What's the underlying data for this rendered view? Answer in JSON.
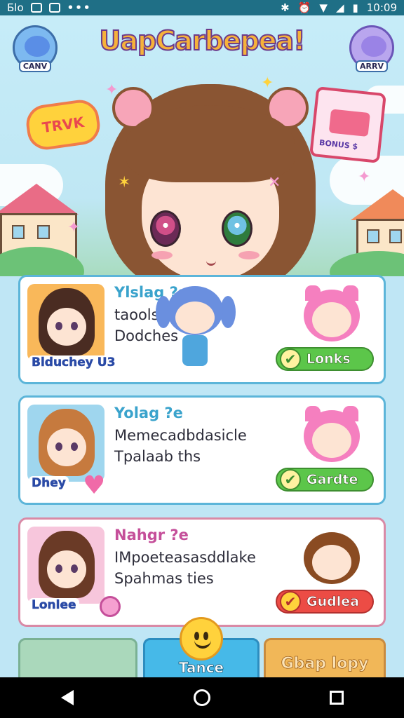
{
  "status_bar": {
    "left_text": "Бlo",
    "dots": "•••",
    "time": "10:09"
  },
  "app": {
    "title": "UapCarbepea!",
    "left_corner_label": "CANV",
    "right_corner_label": "ARRV",
    "talk_badge": "TRVK",
    "shop_sign": "BONUS $"
  },
  "cards": [
    {
      "avatar_name": "Blduchey U3",
      "title": "Ylslag ?s",
      "line1": "taools",
      "line2": "Dodches",
      "action": "Lonks",
      "action_color": "#5cc64a"
    },
    {
      "avatar_name": "Dhey",
      "title": "Yolag ?e",
      "line1": "Memecadbdasicle",
      "line2": "Tpalaab ths",
      "action": "Gardte",
      "action_color": "#5cc64a"
    },
    {
      "avatar_name": "Lonlee",
      "title": "Nahgr ?e",
      "line1": "IMpoeteasasddlake",
      "line2": "Spahmas ties",
      "action": "Gudlea",
      "action_color": "#ec4c45"
    }
  ],
  "bottom_nav": {
    "middle_label": "Tance",
    "right_label": "Gbap lopy"
  },
  "colors": {
    "status_bar": "#1f6f86",
    "sky": "#c6ecf8",
    "card_border_blue": "#5cb5d9",
    "card_border_pink": "#d98aa6"
  },
  "icons": [
    "back-icon",
    "home-icon",
    "recents-icon",
    "bluetooth-icon",
    "wifi-icon",
    "signal-icon",
    "battery-icon",
    "smiley-icon",
    "check-icon"
  ]
}
